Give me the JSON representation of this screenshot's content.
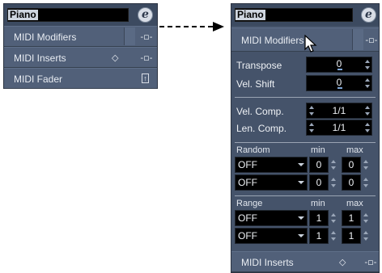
{
  "left_panel": {
    "track_name": "Piano",
    "edit_button": "e",
    "sections": [
      {
        "label": "MIDI Modifiers",
        "icon": "plug-icon",
        "icon_glyph": "-◻-"
      },
      {
        "label": "MIDI Inserts",
        "icon": "plug-icon",
        "icon_glyph": "-◻-",
        "extra_icon": "diamond-icon",
        "extra_glyph": "◇"
      },
      {
        "label": "MIDI Fader",
        "icon": "fader-icon",
        "icon_glyph": "↑"
      }
    ]
  },
  "right_panel": {
    "track_name": "Piano",
    "edit_button": "e",
    "header_section": {
      "label": "MIDI Modifiers",
      "icon_glyph": "-◻-"
    },
    "transpose": {
      "label": "Transpose",
      "value": "0"
    },
    "vel_shift": {
      "label": "Vel. Shift",
      "value": "0"
    },
    "vel_comp": {
      "label": "Vel. Comp.",
      "value": "1/1"
    },
    "len_comp": {
      "label": "Len. Comp.",
      "value": "1/1"
    },
    "random": {
      "label": "Random",
      "min_label": "min",
      "max_label": "max",
      "rows": [
        {
          "mode": "OFF",
          "min": "0",
          "max": "0"
        },
        {
          "mode": "OFF",
          "min": "0",
          "max": "0"
        }
      ]
    },
    "range": {
      "label": "Range",
      "min_label": "min",
      "max_label": "max",
      "rows": [
        {
          "mode": "OFF",
          "min": "1",
          "max": "1"
        },
        {
          "mode": "OFF",
          "min": "1",
          "max": "1"
        }
      ]
    },
    "footer_section": {
      "label": "MIDI Inserts",
      "diamond_glyph": "◇",
      "icon_glyph": "-◻-"
    }
  },
  "colors": {
    "panel": "#45536a",
    "row": "#516079",
    "field": "#000000",
    "text": "#eef1f5"
  }
}
